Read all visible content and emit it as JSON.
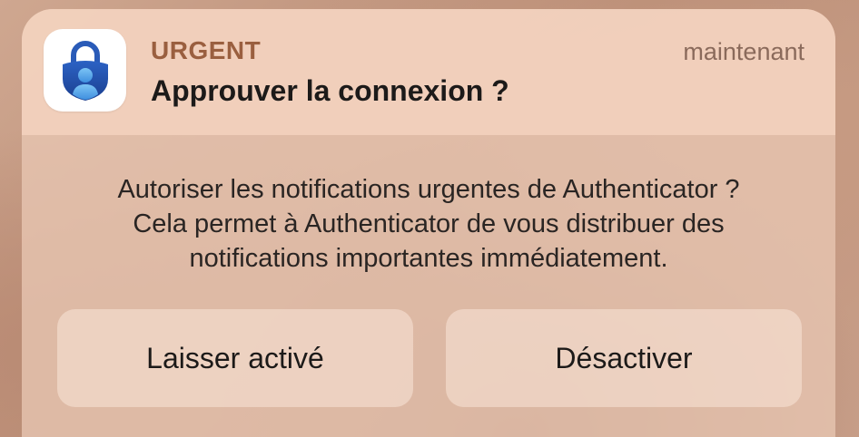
{
  "notification": {
    "app_icon": "authenticator-lock-person-icon",
    "category": "URGENT",
    "timestamp": "maintenant",
    "title": "Approuver la connexion ?",
    "body_lines": [
      "Autoriser les notifications urgentes de Authenticator ?",
      "Cela permet à Authenticator de vous distribuer des",
      "notifications importantes immédiatement."
    ],
    "buttons": {
      "keep_label": "Laisser activé",
      "disable_label": "Désactiver"
    }
  },
  "colors": {
    "category_text": "#9a5f3f",
    "icon_blue_dark": "#1f4fa3",
    "icon_blue_light": "#4ea3e6"
  }
}
